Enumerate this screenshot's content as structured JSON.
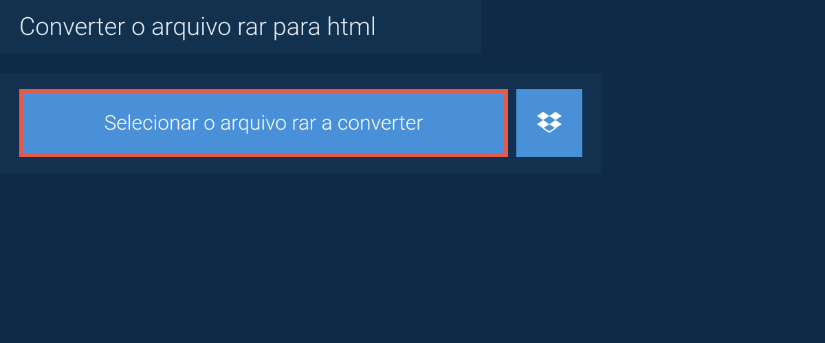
{
  "header": {
    "title": "Converter o arquivo rar para html"
  },
  "main": {
    "select_button_label": "Selecionar o arquivo rar a converter"
  }
}
